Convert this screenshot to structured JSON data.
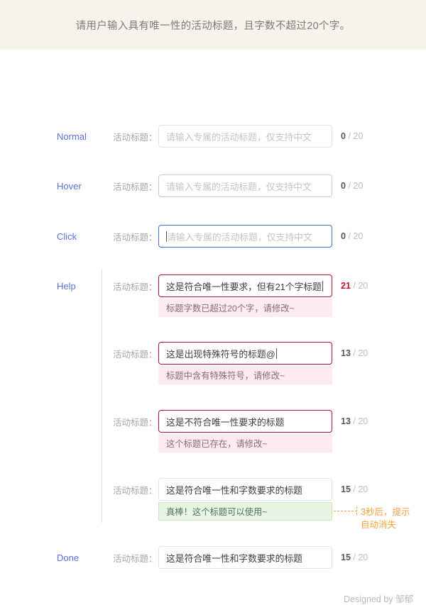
{
  "header": {
    "title": "请用户输入具有唯一性的活动标题，且字数不超过20个字。"
  },
  "field_label": "活动标题：",
  "limit": "/ 20",
  "placeholder": "请输入专属的活动标题，仅支持中文",
  "rows": [
    {
      "state": "Normal",
      "label": "活动标题：",
      "value": "",
      "placeholder": "请输入专属的活动标题，仅支持中文",
      "count": "0",
      "limit": "/ 20"
    },
    {
      "state": "Hover",
      "label": "活动标题：",
      "value": "",
      "placeholder": "请输入专属的活动标题，仅支持中文",
      "count": "0",
      "limit": "/ 20"
    },
    {
      "state": "Click",
      "label": "活动标题：",
      "value": "",
      "placeholder": "请输入专属的活动标题，仅支持中文",
      "count": "0",
      "limit": "/ 20"
    },
    {
      "state": "Help",
      "label": "活动标题：",
      "value": "这是符合唯一性要求，但有21个字标题",
      "count": "21",
      "limit": "/ 20",
      "message": "标题字数已超过20个字，请修改~"
    },
    {
      "state": "",
      "label": "活动标题：",
      "value": "这是出现特殊符号的标题@",
      "count": "13",
      "limit": "/ 20",
      "message": "标题中含有特殊符号，请修改~"
    },
    {
      "state": "",
      "label": "活动标题：",
      "value": "这是不符合唯一性要求的标题",
      "count": "13",
      "limit": "/ 20",
      "message": "这个标题已存在，请修改~"
    },
    {
      "state": "",
      "label": "活动标题：",
      "value": "这是符合唯一性和字数要求的标题",
      "count": "15",
      "limit": "/ 20",
      "message": "真棒！这个标题可以使用~"
    },
    {
      "state": "Done",
      "label": "活动标题：",
      "value": "这是符合唯一性和字数要求的标题",
      "count": "15",
      "limit": "/ 20"
    }
  ],
  "annotation": {
    "line1": "3秒后，提示",
    "line2": "自动消失"
  },
  "footer": "Designed by 邹郁",
  "colors": {
    "header_bg": "#f5f3ec",
    "state_label": "#5b6fd6",
    "focus_border": "#4a68d8",
    "error_border": "#b5122e",
    "error_bg": "#fcebf0",
    "success_bg": "#e9f5e3",
    "success_border": "#cfe6c2",
    "annotation": "#f0a33c",
    "counter_over": "#c8102e"
  }
}
